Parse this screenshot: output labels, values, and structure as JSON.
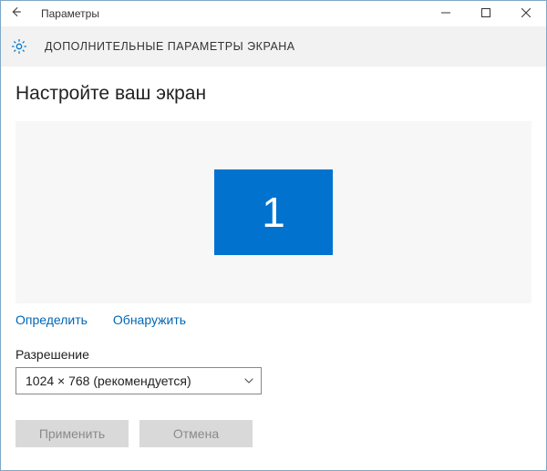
{
  "titlebar": {
    "title": "Параметры"
  },
  "header": {
    "title": "ДОПОЛНИТЕЛЬНЫЕ ПАРАМЕТРЫ ЭКРАНА"
  },
  "page": {
    "heading": "Настройте ваш экран",
    "monitor_number": "1",
    "identify_label": "Определить",
    "detect_label": "Обнаружить",
    "resolution_label": "Разрешение",
    "resolution_value": "1024 × 768 (рекомендуется)",
    "apply_label": "Применить",
    "cancel_label": "Отмена"
  },
  "icons": {
    "back": "back-arrow",
    "gear": "settings-gear",
    "minimize": "minimize",
    "maximize": "maximize",
    "close": "close",
    "chevron": "chevron-down"
  },
  "colors": {
    "accent": "#0173cf",
    "link": "#0066b4",
    "header_bg": "#f2f2f2",
    "panel_bg": "#f7f7f7"
  }
}
